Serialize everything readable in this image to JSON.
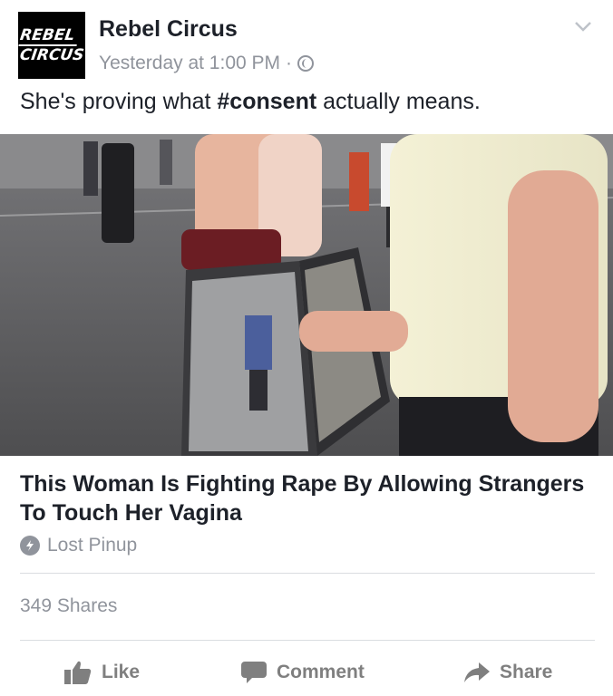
{
  "post": {
    "page_name": "Rebel Circus",
    "avatar_line1": "REBEL",
    "avatar_line2": "CIRCUS",
    "timestamp": "Yesterday at 1:00 PM",
    "separator": "·",
    "privacy_icon": "globe-icon",
    "menu_icon": "chevron-down-icon",
    "text_before": "She's proving what ",
    "hashtag": "#consent",
    "text_after": " actually means."
  },
  "link": {
    "title": "This Woman Is Fighting Rape By Allowing Strangers To Touch Her Vagina",
    "source": "Lost Pinup",
    "source_icon": "bolt-icon"
  },
  "stats": {
    "shares": "349 Shares"
  },
  "actions": [
    {
      "label": "Like",
      "icon": "thumbs-up-icon"
    },
    {
      "label": "Comment",
      "icon": "comment-icon"
    },
    {
      "label": "Share",
      "icon": "share-arrow-icon"
    }
  ],
  "colors": {
    "text": "#1d2129",
    "secondary": "#90949c",
    "action": "#7f7f7f",
    "divider": "#dadde1"
  }
}
